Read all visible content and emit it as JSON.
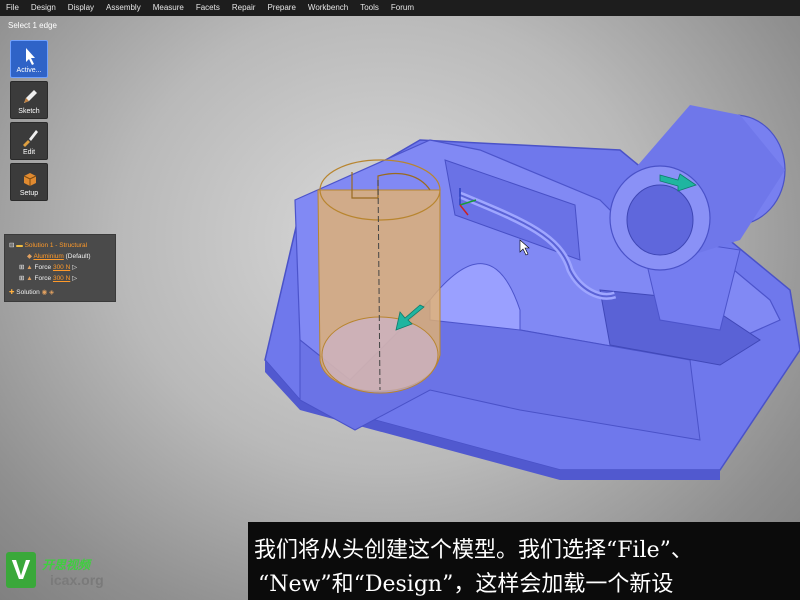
{
  "menu": [
    "File",
    "Design",
    "Display",
    "Assembly",
    "Measure",
    "Facets",
    "Repair",
    "Prepare",
    "Workbench",
    "Tools",
    "Forum"
  ],
  "status_hint": "Select 1 edge",
  "tools": [
    {
      "label": "Active...",
      "icon": "cursor-icon",
      "active": true
    },
    {
      "label": "Sketch",
      "icon": "pencil-icon",
      "active": false
    },
    {
      "label": "Edit",
      "icon": "edit-brush-icon",
      "active": false
    },
    {
      "label": "Setup",
      "icon": "setup-cube-icon",
      "active": false
    }
  ],
  "tree": {
    "solution_title": "Solution 1 - Structural",
    "material_name": "Aluminium",
    "material_suffix": "(Default)",
    "force1_label": "Force",
    "force1_value": "300 N",
    "force2_label": "Force",
    "force2_value": "300 N",
    "solution_label": "Solution"
  },
  "subtitle": {
    "line1": "我们将从头创建这个模型。我们选择“File”、",
    "line2": "“New”和“Design”，这样会加载一个新设"
  },
  "watermark": {
    "brand_cn": "开思视频",
    "domain": "icax.org"
  },
  "colors": {
    "part": "#7d86f2",
    "part_dark": "#5b63d8",
    "cylinder": "#e8b56a",
    "active": "#2f63c7"
  }
}
